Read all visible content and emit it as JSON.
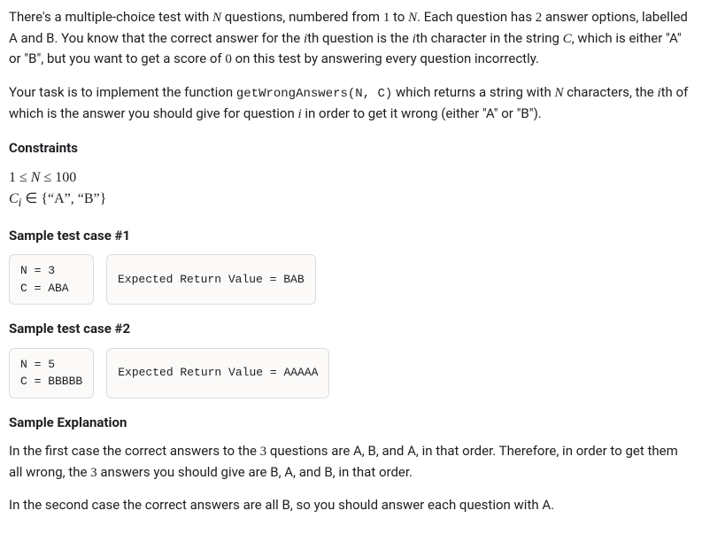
{
  "intro": {
    "p1_a": "There's a multiple-choice test with ",
    "p1_b": " questions, numbered from ",
    "p1_c": " to ",
    "p1_d": ". Each question has ",
    "p1_e": " answer options, labelled A and B. You know that the correct answer for the ",
    "p1_f": "th question is the ",
    "p1_g": "th character in the string ",
    "p1_h": ", which is either \"A\" or \"B\", but you want to get a score of ",
    "p1_i": " on this test by answering every question incorrectly.",
    "N": "N",
    "one": "1",
    "two": "2",
    "zero": "0",
    "i": "i",
    "C": "C"
  },
  "task": {
    "a": "Your task is to implement the function ",
    "fn": "getWrongAnswers(N, C)",
    "b": " which returns a string with ",
    "c": " characters, the ",
    "d": "th of which is the answer you should give for question ",
    "e": " in order to get it wrong (either \"A\" or \"B\")."
  },
  "headings": {
    "constraints": "Constraints",
    "sample1": "Sample test case #1",
    "sample2": "Sample test case #2",
    "explanation": "Sample Explanation"
  },
  "constraints": {
    "line1": "1 ≤ N ≤ 100",
    "line2_a": "C",
    "line2_sub": "i",
    "line2_b": " ∈ {“A”, “B”}"
  },
  "samples": [
    {
      "input": "N = 3\nC = ABA",
      "expected": "Expected Return Value = BAB"
    },
    {
      "input": "N = 5\nC = BBBBB",
      "expected": "Expected Return Value = AAAAA"
    }
  ],
  "explanation": {
    "p1_a": "In the first case the correct answers to the ",
    "p1_b": " questions are A, B, and A, in that order. Therefore, in order to get them all wrong, the ",
    "p1_c": " answers you should give are B, A, and B, in that order.",
    "three": "3",
    "p2": "In the second case the correct answers are all B, so you should answer each question with A."
  }
}
